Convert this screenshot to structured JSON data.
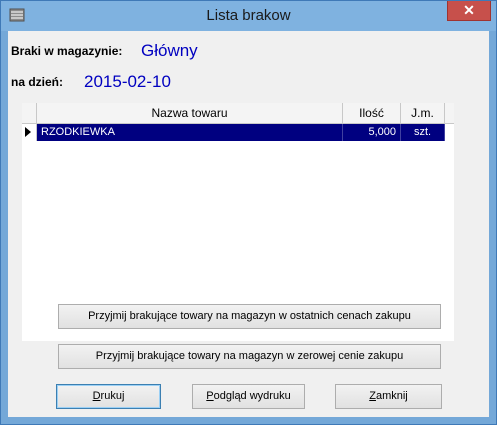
{
  "window": {
    "title": "Lista brakow",
    "close_glyph": "✕"
  },
  "header": {
    "warehouse_label": "Braki w magazynie:",
    "warehouse_value": "Główny",
    "date_label": "na dzień:",
    "date_value": "2015-02-10"
  },
  "grid": {
    "columns": [
      "Nazwa towaru",
      "Ilość",
      "J.m."
    ],
    "rows": [
      {
        "name": "RZODKIEWKA",
        "qty": "5,000",
        "unit": "szt."
      }
    ]
  },
  "actions": {
    "accept_last_price": "Przyjmij brakujące towary na magazyn w ostatnich cenach zakupu",
    "accept_zero_price": "Przyjmij brakujące towary na magazyn w zerowej cenie zakupu",
    "print_first": "D",
    "print_rest": "rukuj",
    "preview_first": "P",
    "preview_rest": "odgląd wydruku",
    "close_first": "Z",
    "close_rest": "amknij"
  },
  "colors": {
    "selection": "#000080",
    "value_text": "#0000c0",
    "close_button": "#c7504b"
  },
  "icons": {
    "system_menu": "window-menu-icon",
    "row_indicator": "row-pointer-icon"
  }
}
